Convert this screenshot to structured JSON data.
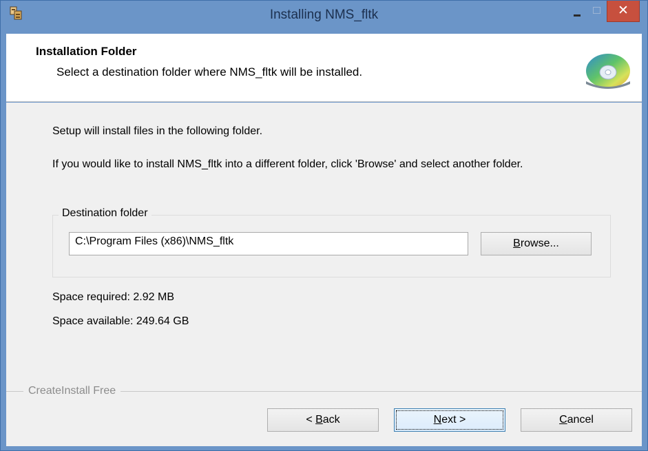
{
  "window": {
    "title": "Installing NMS_fltk",
    "controls": {
      "minimize": "–",
      "maximize": "□",
      "close": "✕"
    }
  },
  "header": {
    "title": "Installation Folder",
    "subtitle": "Select a destination folder where NMS_fltk will be installed."
  },
  "content": {
    "intro1": "Setup will install files in the following folder.",
    "intro2": "If you would like to install NMS_fltk into a different folder, click 'Browse' and select another folder.",
    "group_label": "Destination folder",
    "path_value": "C:\\Program Files (x86)\\NMS_fltk",
    "browse_label_mnemonic": "B",
    "browse_label_rest": "rowse...",
    "space_required": "Space required: 2.92 MB",
    "space_available": "Space available: 249.64 GB"
  },
  "footer": {
    "brand": "CreateInstall Free",
    "back_prefix": "< ",
    "back_mnemonic": "B",
    "back_rest": "ack",
    "next_mnemonic": "N",
    "next_rest": "ext >",
    "cancel_mnemonic": "C",
    "cancel_rest": "ancel"
  },
  "colors": {
    "titlebar": "#6b95c8",
    "close_button": "#c7503e",
    "content_bg": "#f0f0f0"
  },
  "icons": {
    "app": "installer-app-icon",
    "header": "cd-disc-icon"
  }
}
